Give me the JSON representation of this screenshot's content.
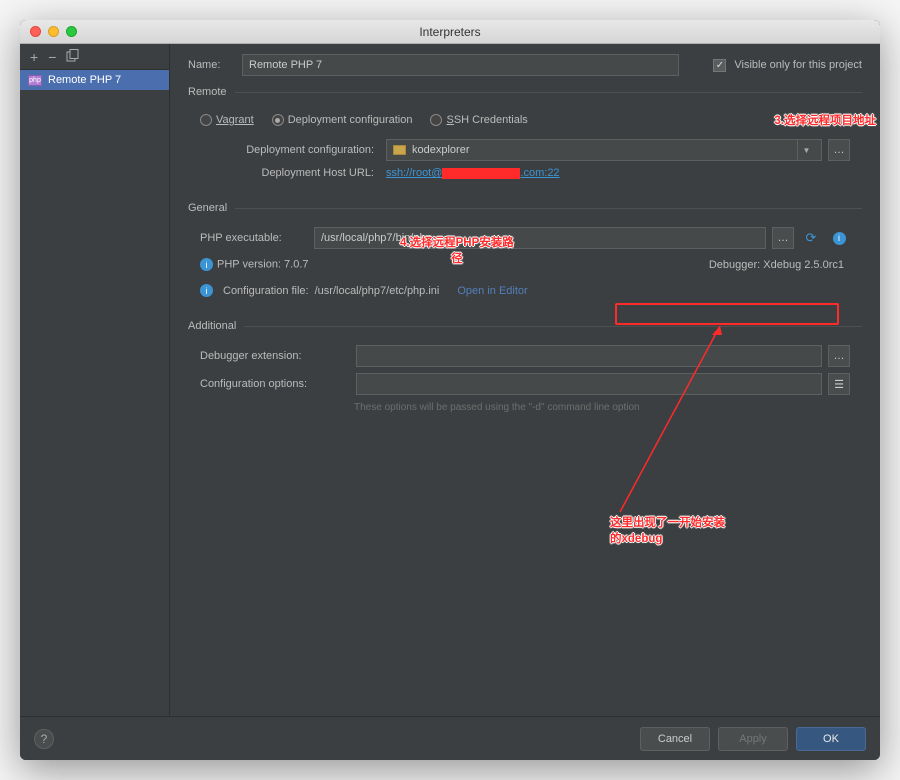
{
  "window": {
    "title": "Interpreters"
  },
  "sidebar": {
    "items": [
      {
        "label": "Remote PHP 7"
      }
    ]
  },
  "form": {
    "name_label": "Name:",
    "name_value": "Remote PHP 7",
    "visible_label": "Visible only for this project"
  },
  "remote": {
    "legend": "Remote",
    "radios": {
      "vagrant": "Vagrant",
      "deploy": "Deployment configuration",
      "ssh": "SSH Credentials"
    },
    "deploy_conf_label": "Deployment configuration:",
    "deploy_conf_value": "kodexplorer",
    "deploy_host_label": "Deployment Host URL:",
    "deploy_host_prefix": "ssh://root@",
    "deploy_host_suffix": ".com:22"
  },
  "general": {
    "legend": "General",
    "exec_label": "PHP executable:",
    "exec_value": "/usr/local/php7/bin/php",
    "version_label": "PHP version: 7.0.7",
    "debugger_label": "Debugger: Xdebug 2.5.0rc1",
    "conf_label_a": "Configuration file: ",
    "conf_value": "/usr/local/php7/etc/php.ini",
    "conf_link": "Open in Editor"
  },
  "additional": {
    "legend": "Additional",
    "ext_label": "Debugger extension:",
    "opts_label": "Configuration options:",
    "hint": "These options will be passed using the \"-d\" command line option"
  },
  "footer": {
    "cancel": "Cancel",
    "apply": "Apply",
    "ok": "OK"
  },
  "annotations": {
    "a3": "3.选择远程项目地址",
    "a4a": "4.选择远程PHP安装路",
    "a4b": "径",
    "a5a": "这里出现了一开始安装",
    "a5b": "的xdebug"
  }
}
